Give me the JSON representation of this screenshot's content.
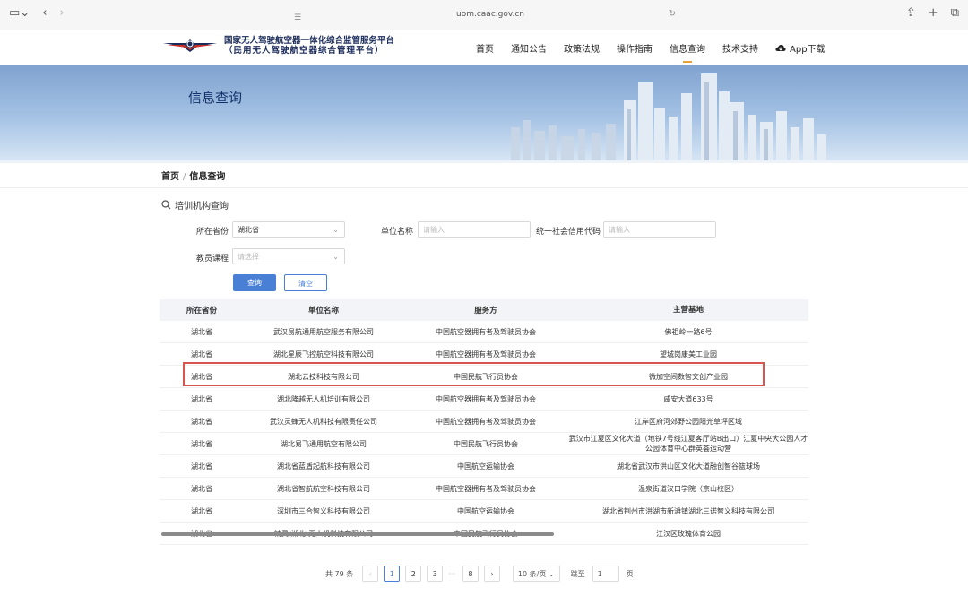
{
  "browser": {
    "url": "uom.caac.gov.cn"
  },
  "site": {
    "title_line1": "国家无人驾驶航空器一体化综合监管服务平台",
    "title_line2": "（民用无人驾驶航空器综合管理平台）"
  },
  "nav": {
    "items": [
      "首页",
      "通知公告",
      "政策法规",
      "操作指南",
      "信息查询",
      "技术支持"
    ],
    "app_download": "App下载"
  },
  "banner": {
    "title": "信息查询"
  },
  "breadcrumb": {
    "home": "首页",
    "sep": "/",
    "current": "信息查询"
  },
  "section": {
    "title": "培训机构查询"
  },
  "form": {
    "province_label": "所在省份",
    "province_value": "湖北省",
    "unit_label": "单位名称",
    "unit_placeholder": "请输入",
    "credit_label": "统一社会信用代码",
    "credit_placeholder": "请输入",
    "course_label": "教员课程",
    "course_placeholder": "请选择",
    "search_btn": "查询",
    "clear_btn": "清空"
  },
  "table": {
    "headers": [
      "所在省份",
      "单位名称",
      "服务方",
      "主营基地"
    ],
    "rows": [
      [
        "湖北省",
        "武汉易航通用航空服务有限公司",
        "中国航空器拥有者及驾驶员协会",
        "佛祖岭一路6号"
      ],
      [
        "湖北省",
        "湖北星辰飞控航空科技有限公司",
        "中国航空器拥有者及驾驶员协会",
        "望城岗康美工业园"
      ],
      [
        "湖北省",
        "湖北云技科技有限公司",
        "中国民航飞行员协会",
        "微加空间数智文创产业园"
      ],
      [
        "湖北省",
        "湖北隆越无人机培训有限公司",
        "中国航空器拥有者及驾驶员协会",
        "咸安大道633号"
      ],
      [
        "湖北省",
        "武汉灵蜂无人机科技有限责任公司",
        "中国航空器拥有者及驾驶员协会",
        "江岸区府河郊野公园阳光草坪区域"
      ],
      [
        "湖北省",
        "湖北易飞通用航空有限公司",
        "中国民航飞行员协会",
        "武汉市江夏区文化大道（地铁7号线江夏客厅站B出口）江夏中央大公园人才公园体育中心群英荟运动营"
      ],
      [
        "湖北省",
        "湖北省蓝盾起航科技有限公司",
        "中国航空运输协会",
        "湖北省武汉市洪山区文化大道融创智谷篮球场"
      ],
      [
        "湖北省",
        "湖北省智航航空科技有限公司",
        "中国航空器拥有者及驾驶员协会",
        "温泉街道汉口学院（京山校区）"
      ],
      [
        "湖北省",
        "深圳市三合智义科技有限公司",
        "中国航空运输协会",
        "湖北省荆州市洪湖市新滩镇湖北三诺智义科技有限公司"
      ],
      [
        "湖北省",
        "精灵(湖北)无人机科技有限公司",
        "中国民航飞行员协会",
        "江汉区玫瑰体育公园"
      ]
    ]
  },
  "pagination": {
    "total": "共 79 条",
    "prev": "‹",
    "pages": [
      "1",
      "2",
      "3"
    ],
    "ellipsis": "···",
    "last": "8",
    "next": "›",
    "page_size": "10 条/页",
    "jump_label": "跳至",
    "jump_value": "1",
    "page_unit": "页",
    "current_page": "1"
  }
}
